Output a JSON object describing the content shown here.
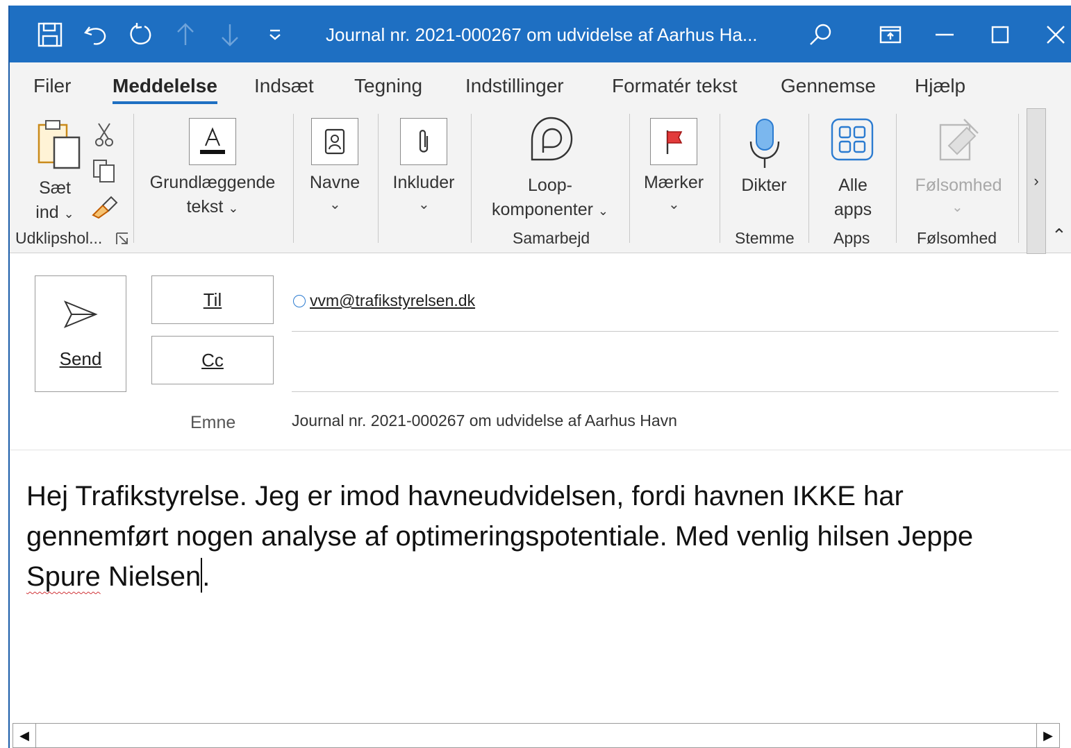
{
  "window": {
    "title": "Journal nr. 2021-000267 om udvidelse af Aarhus Ha...",
    "accent_color": "#1e6fc2"
  },
  "titlebar_icons": [
    "save-icon",
    "undo-icon",
    "redo-icon",
    "arrow-up-icon",
    "arrow-down-icon",
    "customize-toolbar-icon",
    "search-icon",
    "ribbon-display-icon",
    "minimize-icon",
    "maximize-icon",
    "close-icon"
  ],
  "tabs": [
    {
      "label": "Filer"
    },
    {
      "label": "Meddelelse",
      "active": true
    },
    {
      "label": "Indsæt"
    },
    {
      "label": "Tegning"
    },
    {
      "label": "Indstillinger"
    },
    {
      "label": "Formatér tekst"
    },
    {
      "label": "Gennemse"
    },
    {
      "label": "Hjælp"
    }
  ],
  "ribbon": {
    "paste": {
      "line1": "Sæt",
      "line2": "ind"
    },
    "clipboard_group": "Udklipshol...",
    "basic_text": {
      "line1": "Grundlæggende",
      "line2": "tekst"
    },
    "names": "Navne",
    "include": "Inkluder",
    "loop": {
      "line1": "Loop-",
      "line2": "komponenter"
    },
    "collab_group": "Samarbejd",
    "tags": "Mærker",
    "dictate": "Dikter",
    "voice_group": "Stemme",
    "all_apps": {
      "line1": "Alle",
      "line2": "apps"
    },
    "apps_group": "Apps",
    "sensitivity": "Følsomhed",
    "sensitivity_group": "Følsomhed"
  },
  "compose": {
    "send_label": "Send",
    "to_label": "Til",
    "cc_label": "Cc",
    "subject_label": "Emne",
    "to_recipient": "vvm@trafikstyrelsen.dk",
    "cc_value": "",
    "subject_value": "Journal nr. 2021-000267 om udvidelse af Aarhus Havn"
  },
  "body": {
    "text_before": "Hej Trafikstyrelse. Jeg er imod havneudvidelsen, fordi havnen IKKE har gennemført nogen analyse af optimeringspotentiale. Med venlig hilsen Jeppe ",
    "misspelled": "Spure",
    "text_after_word": " Nielsen",
    "text_end": "."
  }
}
